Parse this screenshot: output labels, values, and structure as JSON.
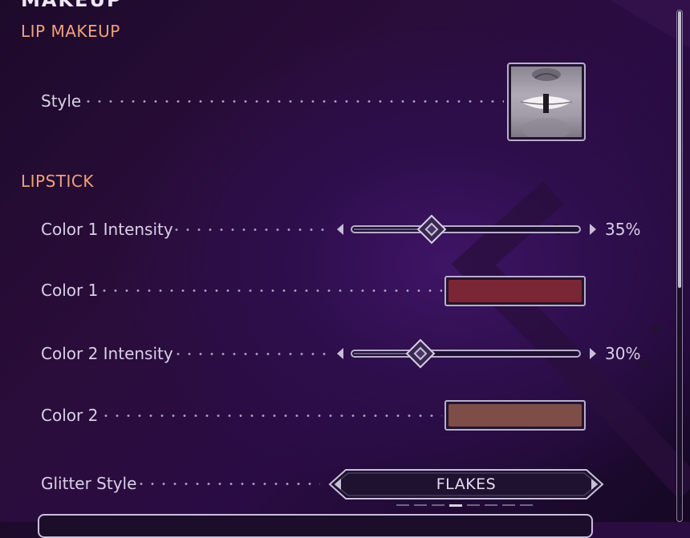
{
  "header": {
    "title": "MAKEUP"
  },
  "sections": {
    "lip_makeup": "LIP MAKEUP",
    "lipstick": "LIPSTICK"
  },
  "rows": {
    "style": {
      "label": "Style"
    },
    "color1_intensity": {
      "label": "Color 1 Intensity",
      "value": 35,
      "value_text": "35%"
    },
    "color1": {
      "label": "Color 1",
      "color": "#7b2635"
    },
    "color2_intensity": {
      "label": "Color 2 Intensity",
      "value": 30,
      "value_text": "30%"
    },
    "color2": {
      "label": "Color 2",
      "color": "#7e4d48"
    },
    "glitter_style": {
      "label": "Glitter Style",
      "value": "FLAKES",
      "page_count": 8,
      "active_page": 4
    }
  },
  "colors": {
    "section_heading": "#f0a27a",
    "background": "#2a0d3a",
    "frame": "#b7aecb"
  },
  "icons": {
    "left_arrow": "triangle-left",
    "right_arrow": "triangle-right",
    "slider_thumb": "diamond"
  }
}
